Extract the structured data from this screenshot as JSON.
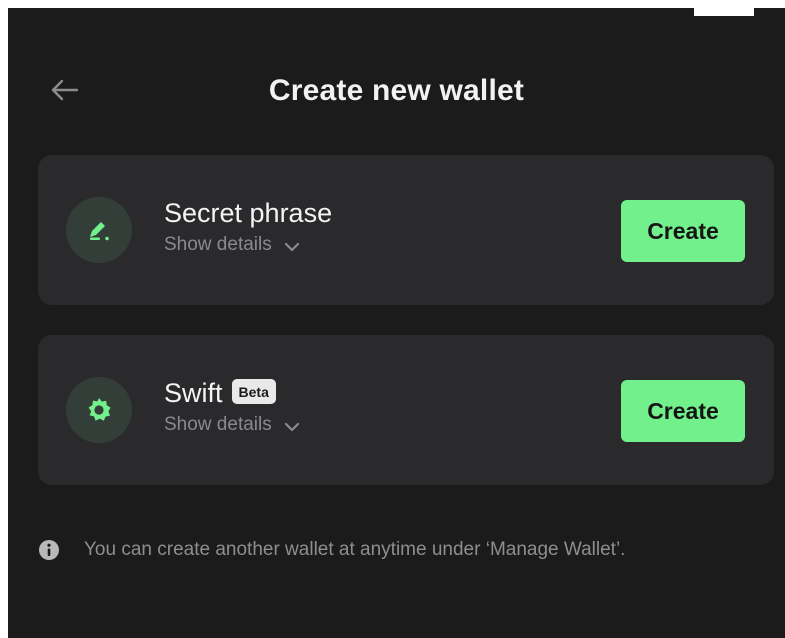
{
  "header": {
    "title": "Create new wallet",
    "back_icon": "arrow-left-icon"
  },
  "options": [
    {
      "title": "Secret phrase",
      "badge": "",
      "details_label": "Show details",
      "button_label": "Create",
      "icon": "pencil-icon"
    },
    {
      "title": "Swift",
      "badge": "Beta",
      "details_label": "Show details",
      "button_label": "Create",
      "icon": "swift-badge-icon"
    }
  ],
  "info": {
    "text": "You can create another wallet at anytime under ‘Manage Wallet’.",
    "icon": "info-icon"
  },
  "colors": {
    "background": "#1b1b1c",
    "card": "#2a2a2c",
    "accent": "#72f08c",
    "icon_circle": "#343e38",
    "muted_text": "#8a8a8c"
  }
}
